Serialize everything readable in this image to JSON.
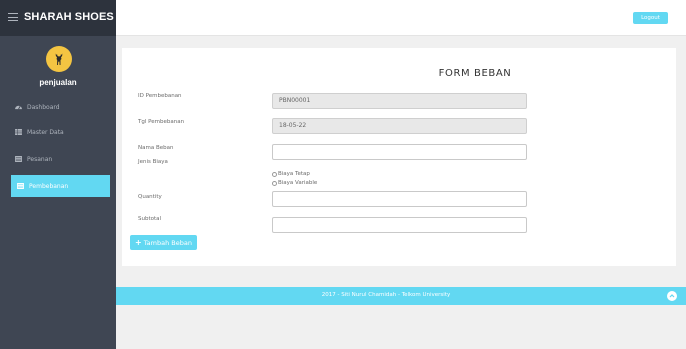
{
  "brand": {
    "title": "SHARAH SHOES"
  },
  "user": {
    "name": "penjualan"
  },
  "sidebar": {
    "items": [
      {
        "label": "Dashboard",
        "icon": "dashboard-icon",
        "active": false
      },
      {
        "label": "Master Data",
        "icon": "table-icon",
        "active": false
      },
      {
        "label": "Pesanan",
        "icon": "list-icon",
        "active": false
      },
      {
        "label": "Pembebanan",
        "icon": "list-icon",
        "active": true
      }
    ]
  },
  "header": {
    "logout_label": "Logout"
  },
  "form": {
    "title": "FORM BEBAN",
    "id_label": "ID Pembebanan",
    "id_value": "PBN00001",
    "tgl_label": "Tgl Pembebanan",
    "tgl_value": "18-05-22",
    "nama_label": "Nama Beban",
    "nama_value": "",
    "jenis_label": "Jenis Biaya",
    "jenis_options": [
      "Biaya Tetap",
      "Biaya Variable"
    ],
    "quantity_label": "Quantity",
    "quantity_value": "",
    "subtotal_label": "Subtotal",
    "subtotal_value": "",
    "add_button_label": "Tambah Beban"
  },
  "footer": {
    "text": "2017 - Siti Nurul Chamidah - Telkom University"
  },
  "colors": {
    "accent": "#62d8f2",
    "sidebar": "#3f4653",
    "brand_bar": "#2d333d",
    "avatar": "#f4c542"
  }
}
